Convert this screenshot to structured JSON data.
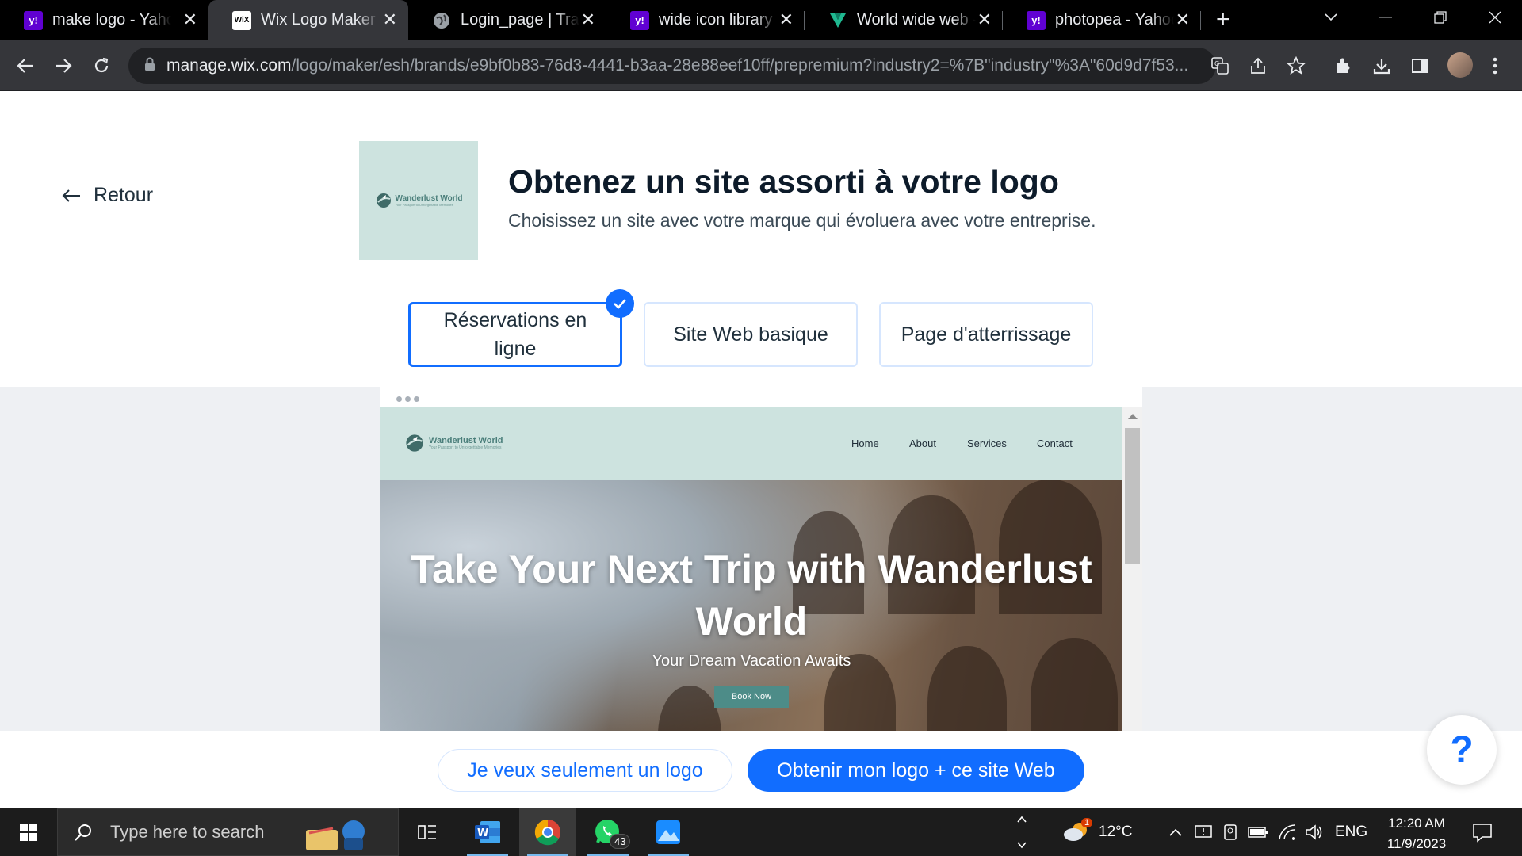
{
  "browser": {
    "tabs": [
      {
        "title": "make logo - Yahoo",
        "favicon": "yahoo-icon",
        "active": false
      },
      {
        "title": "Wix Logo Maker",
        "favicon": "wix-icon",
        "active": true
      },
      {
        "title": "Login_page | Trave",
        "favicon": "globe-icon",
        "active": false
      },
      {
        "title": "wide icon library -",
        "favicon": "yahoo-icon",
        "active": false
      },
      {
        "title": "World wide web - I",
        "favicon": "vuetify-icon",
        "active": false
      },
      {
        "title": "photopea - Yahoo",
        "favicon": "yahoo-icon",
        "active": false
      }
    ],
    "url_host": "manage.wix.com",
    "url_path": "/logo/maker/esh/brands/e9bf0b83-76d3-4441-b3aa-28e88eef10ff/prepremium?industry2=%7B\"industry\"%3A\"60d9d7f53..."
  },
  "page": {
    "back_label": "Retour",
    "headline": "Obtenez un site assorti à votre logo",
    "subline": "Choisissez un site avec votre marque qui évoluera avec votre entreprise.",
    "logo": {
      "name": "Wanderlust World",
      "tagline": "Your Passport to Unforgettable Memories"
    },
    "options": [
      {
        "label": "Réservations en ligne",
        "selected": true
      },
      {
        "label": "Site Web basique",
        "selected": false
      },
      {
        "label": "Page d'atterrissage",
        "selected": false
      }
    ],
    "preview": {
      "brand": "Wanderlust World",
      "tagline": "Your Passport to Unforgettable Memories",
      "nav": [
        "Home",
        "About",
        "Services",
        "Contact"
      ],
      "hero_title": "Take Your Next Trip with Wanderlust World",
      "hero_sub": "Your Dream Vacation Awaits",
      "cta": "Book Now"
    },
    "buttons": {
      "logo_only": "Je veux seulement un logo",
      "logo_site": "Obtenir mon logo + ce site Web"
    },
    "help": "?"
  },
  "taskbar": {
    "search_placeholder": "Type here to search",
    "whatsapp_badge": "43",
    "weather": "12°C",
    "weather_badge": "1",
    "language": "ENG",
    "time": "12:20 AM",
    "date": "11/9/2023"
  },
  "colors": {
    "accent": "#116dff",
    "brand_teal": "#4a7e7a",
    "logo_bg": "#cde3df"
  }
}
